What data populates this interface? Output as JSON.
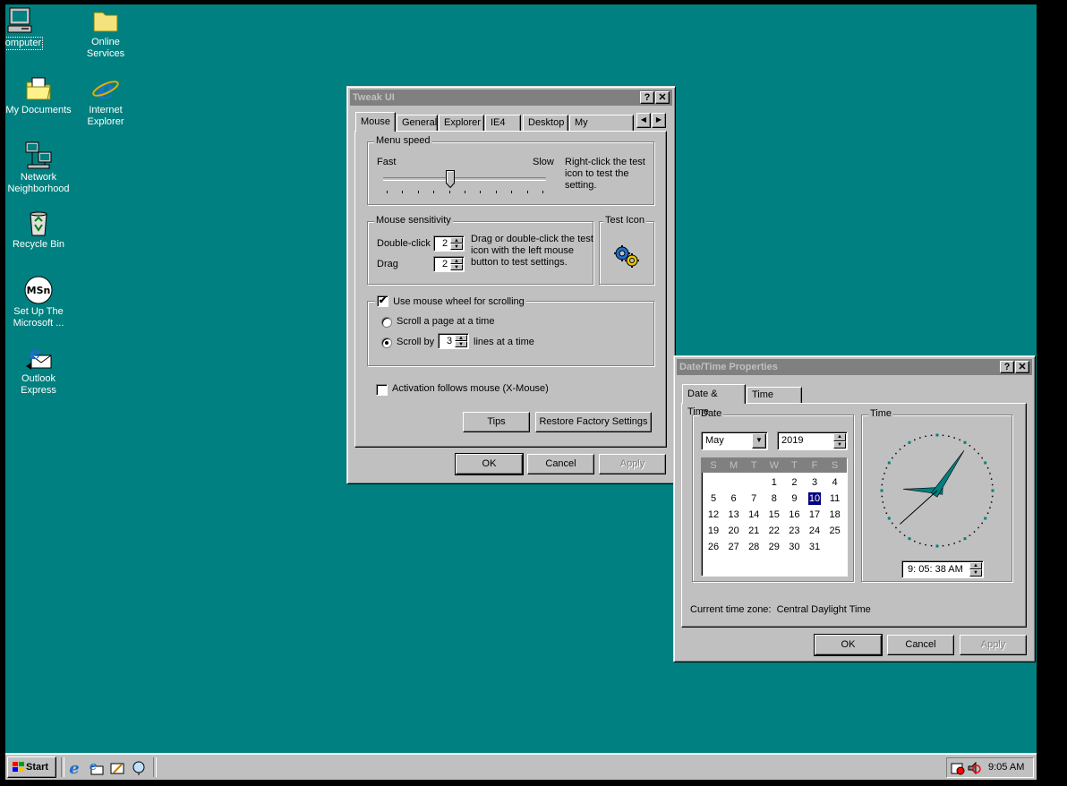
{
  "desktop": {
    "icons": [
      {
        "label": "My Computer",
        "shown": "Computer"
      },
      {
        "label1": "Online",
        "label2": "Services"
      },
      {
        "label": "My Documents"
      },
      {
        "label1": "Internet",
        "label2": "Explorer"
      },
      {
        "label1": "Network",
        "label2": "Neighborhood"
      },
      {
        "label": "Recycle Bin"
      },
      {
        "label1": "Set Up The",
        "label2": "Microsoft ..."
      },
      {
        "label1": "Outlook",
        "label2": "Express"
      }
    ]
  },
  "tweakui": {
    "title": "Tweak UI",
    "help_btn": "?",
    "close_btn": "✕",
    "tabs": [
      "Mouse",
      "General",
      "Explorer",
      "IE4",
      "Desktop",
      "My Computer"
    ],
    "scroll_left": "◀",
    "scroll_right": "▶",
    "menu_speed": {
      "label": "Menu speed",
      "fast": "Fast",
      "slow": "Slow",
      "hint": "Right-click the test icon to test the setting.",
      "slider_position": 0.41
    },
    "sensitivity": {
      "label": "Mouse sensitivity",
      "double_click_label": "Double-click",
      "double_click_value": "2",
      "drag_label": "Drag",
      "drag_value": "2",
      "hint": "Drag or double-click the test icon with the left mouse button to test settings."
    },
    "test_icon": {
      "label": "Test Icon"
    },
    "wheel": {
      "checkbox_label": "Use mouse wheel for scrolling",
      "checked": "✔",
      "option_page": "Scroll a page at a time",
      "option_by": "Scroll by",
      "lines_value": "3",
      "lines_suffix": "lines at a time"
    },
    "xmouse_label": "Activation follows mouse (X-Mouse)",
    "tips_btn": "Tips",
    "restore_btn": "Restore Factory Settings",
    "ok": "OK",
    "cancel": "Cancel",
    "apply": "Apply"
  },
  "datetime": {
    "title": "Date/Time Properties",
    "help_btn": "?",
    "close_btn": "✕",
    "tabs": [
      "Date & Time",
      "Time Zone"
    ],
    "date_group": "Date",
    "time_group": "Time",
    "month": "May",
    "year": "2019",
    "weekdays": [
      "S",
      "M",
      "T",
      "W",
      "T",
      "F",
      "S"
    ],
    "weeks": [
      [
        "",
        "",
        "",
        "1",
        "2",
        "3",
        "4"
      ],
      [
        "5",
        "6",
        "7",
        "8",
        "9",
        "10",
        "11"
      ],
      [
        "12",
        "13",
        "14",
        "15",
        "16",
        "17",
        "18"
      ],
      [
        "19",
        "20",
        "21",
        "22",
        "23",
        "24",
        "25"
      ],
      [
        "26",
        "27",
        "28",
        "29",
        "30",
        "31",
        ""
      ]
    ],
    "selected_day": "10",
    "time_value": "9: 05: 38 AM",
    "clock": {
      "hour": 9,
      "minute": 5,
      "second": 38
    },
    "timezone_label": "Current time zone:",
    "timezone_value": "Central Daylight Time",
    "ok": "OK",
    "cancel": "Cancel",
    "apply": "Apply"
  },
  "taskbar": {
    "start_label": "Start",
    "clock": "9:05 AM"
  },
  "colors": {
    "desktop": "#008080",
    "face": "#c0c0c0",
    "selection": "#000080"
  }
}
